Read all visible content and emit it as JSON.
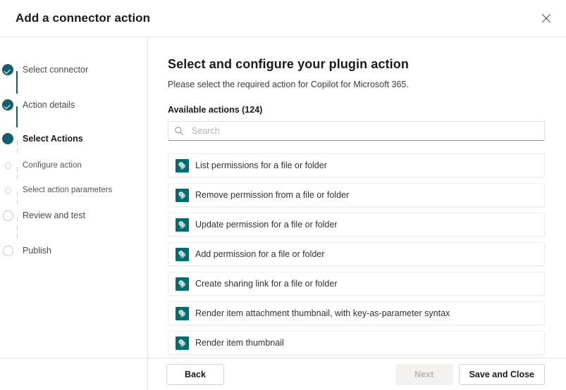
{
  "dialog": {
    "title": "Add a connector action",
    "close_icon": "close-icon"
  },
  "sidebar": {
    "steps": [
      {
        "label": "Select connector",
        "state": "done",
        "size": "lg"
      },
      {
        "label": "Action details",
        "state": "done",
        "size": "lg"
      },
      {
        "label": "Select Actions",
        "state": "active",
        "size": "lg"
      },
      {
        "label": "Configure action",
        "state": "pending",
        "size": "sm"
      },
      {
        "label": "Select action parameters",
        "state": "pending",
        "size": "sm"
      },
      {
        "label": "Review and test",
        "state": "pending",
        "size": "lg"
      },
      {
        "label": "Publish",
        "state": "pending",
        "size": "lg"
      }
    ]
  },
  "main": {
    "heading": "Select and configure your plugin action",
    "subtitle": "Please select the required action for Copilot for Microsoft 365.",
    "available_label": "Available actions (124)",
    "available_count": 124,
    "search": {
      "placeholder": "Search",
      "value": "",
      "icon": "search-icon"
    },
    "actions": [
      {
        "label": "List permissions for a file or folder",
        "icon": "sharepoint-icon"
      },
      {
        "label": "Remove permission from a file or folder",
        "icon": "sharepoint-icon"
      },
      {
        "label": "Update permission for a file or folder",
        "icon": "sharepoint-icon"
      },
      {
        "label": "Add permission for a file or folder",
        "icon": "sharepoint-icon"
      },
      {
        "label": "Create sharing link for a file or folder",
        "icon": "sharepoint-icon"
      },
      {
        "label": "Render item attachment thumbnail, with key-as-parameter syntax",
        "icon": "sharepoint-icon"
      },
      {
        "label": "Render item thumbnail",
        "icon": "sharepoint-icon"
      }
    ]
  },
  "footer": {
    "back_label": "Back",
    "next_label": "Next",
    "save_label": "Save and Close"
  },
  "colors": {
    "accent": "#12606e",
    "sharepoint_teal": "#036C70",
    "divider": "#e3e3e3",
    "text_primary": "#1b1a19",
    "disabled_bg": "#f3f2f1",
    "disabled_text": "#b8b6b4"
  }
}
